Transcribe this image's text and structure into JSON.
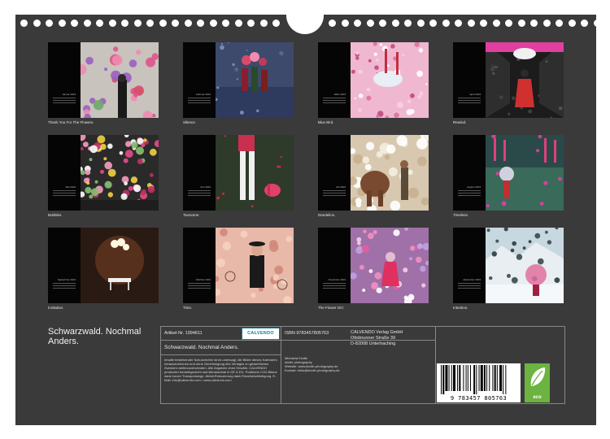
{
  "calendar_title": "Schwarzwald. Nochmal Anders.",
  "months": [
    {
      "caption": "Thank You For The Flowers.",
      "month": "Januar 2024",
      "theme": "flowers"
    },
    {
      "caption": "Silence.",
      "month": "Februar 2024",
      "theme": "silence"
    },
    {
      "caption": "Blue Bird.",
      "month": "März 2024",
      "theme": "bluebird"
    },
    {
      "caption": "Rewind.",
      "month": "April 2024",
      "theme": "rewind"
    },
    {
      "caption": "Bubbles.",
      "month": "Mai 2024",
      "theme": "bubbles"
    },
    {
      "caption": "Twosome.",
      "month": "Juni 2024",
      "theme": "twosome"
    },
    {
      "caption": "Dandelion.",
      "month": "Juli 2024",
      "theme": "dandelion"
    },
    {
      "caption": "Timeless.",
      "month": "August 2024",
      "theme": "timeless"
    },
    {
      "caption": "Invitation.",
      "month": "September 2024",
      "theme": "invitation"
    },
    {
      "caption": "Time.",
      "month": "Oktober 2024",
      "theme": "time"
    },
    {
      "caption": "The Flower Girl.",
      "month": "November 2024",
      "theme": "flowergirl"
    },
    {
      "caption": "Intention.",
      "month": "Dezember 2024",
      "theme": "intention"
    }
  ],
  "info": {
    "article": "Artikel-Nr. 1994611",
    "publisher_logo": "CALVENDO",
    "isbn": "ISBN 9783457805763",
    "publisher_lines": [
      "CALVENDO Verlag GmbH",
      "Ottobrunner Straße 39",
      "D-82008 Unterhaching"
    ],
    "subtitle": "Schwarzwald. Nochmal Anders.",
    "legal": "Inhalte bestehender Schutzrechte ist es untersagt, die Bilder dieses Kalenders herauszutrennen und ohne Genehmigung des Verlages zu gewerblichen Zwecken weiterzuverwenden. Alle Angaben ohne Gewähr. CALVENDO produziert bedarfsgerecht und klimaneutral in DE & EU. Positivere CO2-Bilanz dank kurzer Transportwege. Abfall-Reduzierung dank Einzelstückfertigung. E-Mail: info@calvendo.com • www.calvendo.com",
    "author_lines": [
      "Michaela Kindle",
      "kindle photography",
      "Website: www.kindle-photography.de",
      "Kontakt: hello@kindle-photography.de"
    ],
    "barcode_number": "9 783457 805763",
    "eco_label": "eco"
  },
  "colors": {
    "page_bg": "#3a3a3a",
    "barcode_bg": "#ffffff",
    "eco_green": "#6cb33f"
  }
}
